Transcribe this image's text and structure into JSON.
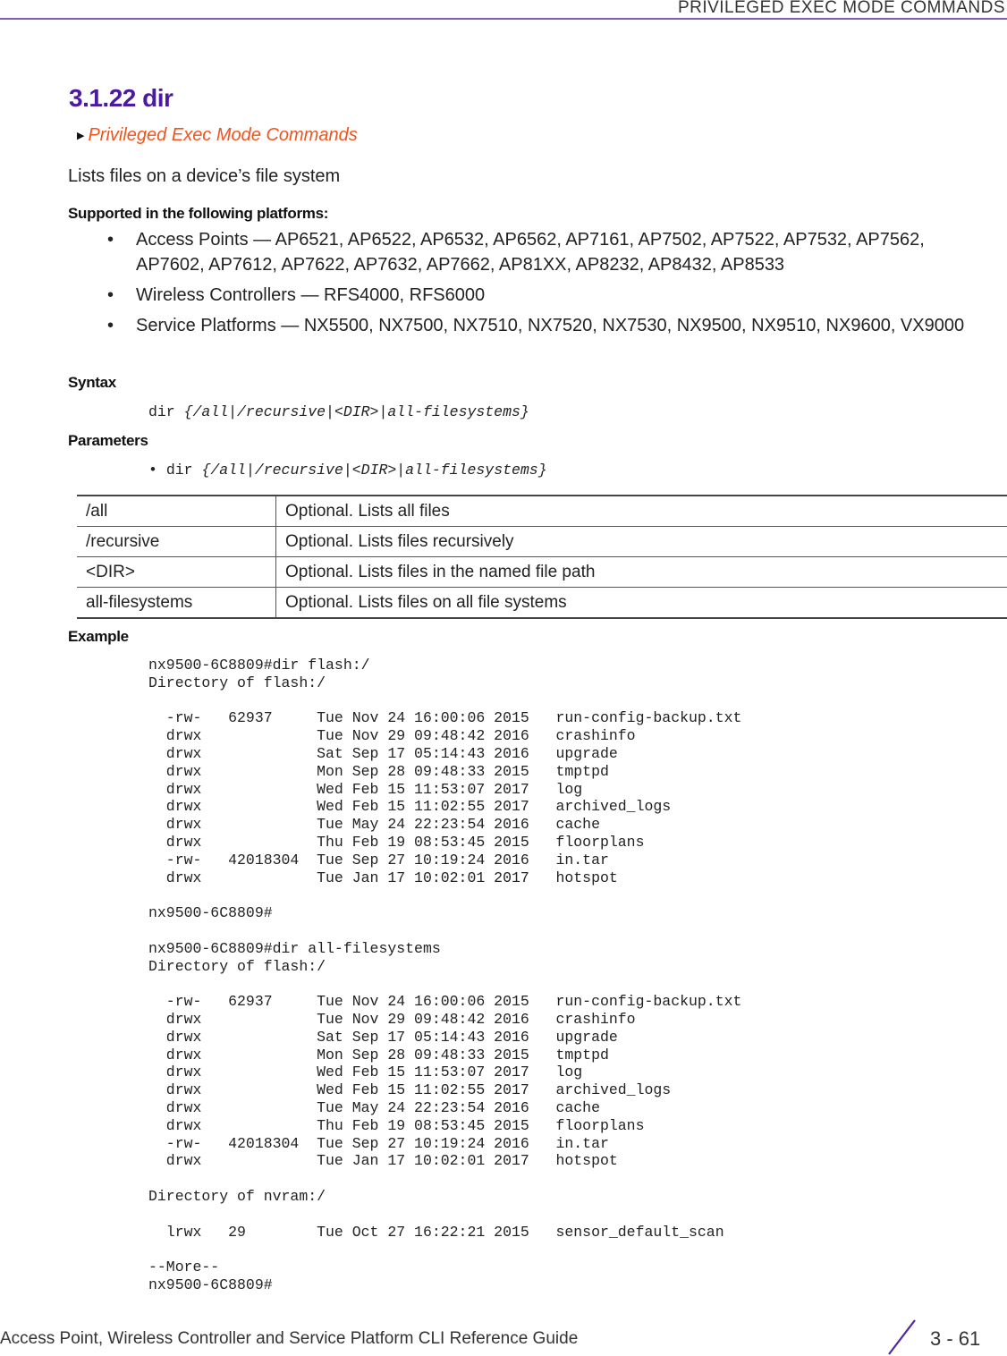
{
  "header": {
    "running_title": "PRIVILEGED EXEC MODE COMMANDS",
    "rule_color": "#7d5cc4"
  },
  "section": {
    "title": "3.1.22 dir",
    "breadcrumb_link": "Privileged Exec Mode Commands",
    "description": "Lists files on a device’s file system"
  },
  "platforms": {
    "heading": "Supported in the following platforms:",
    "bullet": "•",
    "items": [
      "Access Points — AP6521, AP6522, AP6532, AP6562, AP7161, AP7502, AP7522, AP7532, AP7562, AP7602, AP7612, AP7622, AP7632, AP7662, AP81XX, AP8232, AP8432, AP8533",
      "Wireless Controllers — RFS4000, RFS6000",
      "Service Platforms — NX5500, NX7500, NX7510, NX7520, NX7530, NX9500, NX9510, NX9600, VX9000"
    ]
  },
  "syntax": {
    "heading": "Syntax",
    "command": "dir",
    "args": "{/all|/recursive|<DIR>|all-filesystems}"
  },
  "parameters": {
    "heading": "Parameters",
    "bullet": "•",
    "command": "dir",
    "args": "{/all|/recursive|<DIR>|all-filesystems}",
    "rows": [
      {
        "param": "/all",
        "desc": "Optional. Lists all files"
      },
      {
        "param": "/recursive",
        "desc": "Optional. Lists files recursively"
      },
      {
        "param": "<DIR>",
        "desc": "Optional. Lists files in the named file path"
      },
      {
        "param": "all-filesystems",
        "desc": "Optional. Lists files on all file systems"
      }
    ]
  },
  "example": {
    "heading": "Example",
    "code": "nx9500-6C8809#dir flash:/\nDirectory of flash:/\n\n  -rw-   62937     Tue Nov 24 16:00:06 2015   run-config-backup.txt\n  drwx             Tue Nov 29 09:48:42 2016   crashinfo\n  drwx             Sat Sep 17 05:14:43 2016   upgrade\n  drwx             Mon Sep 28 09:48:33 2015   tmptpd\n  drwx             Wed Feb 15 11:53:07 2017   log\n  drwx             Wed Feb 15 11:02:55 2017   archived_logs\n  drwx             Tue May 24 22:23:54 2016   cache\n  drwx             Thu Feb 19 08:53:45 2015   floorplans\n  -rw-   42018304  Tue Sep 27 10:19:24 2016   in.tar\n  drwx             Tue Jan 17 10:02:01 2017   hotspot\n\nnx9500-6C8809#\n\nnx9500-6C8809#dir all-filesystems\nDirectory of flash:/\n\n  -rw-   62937     Tue Nov 24 16:00:06 2015   run-config-backup.txt\n  drwx             Tue Nov 29 09:48:42 2016   crashinfo\n  drwx             Sat Sep 17 05:14:43 2016   upgrade\n  drwx             Mon Sep 28 09:48:33 2015   tmptpd\n  drwx             Wed Feb 15 11:53:07 2017   log\n  drwx             Wed Feb 15 11:02:55 2017   archived_logs\n  drwx             Tue May 24 22:23:54 2016   cache\n  drwx             Thu Feb 19 08:53:45 2015   floorplans\n  -rw-   42018304  Tue Sep 27 10:19:24 2016   in.tar\n  drwx             Tue Jan 17 10:02:01 2017   hotspot\n\nDirectory of nvram:/\n\n  lrwx   29        Tue Oct 27 16:22:21 2015   sensor_default_scan\n\n--More--\nnx9500-6C8809#"
  },
  "footer": {
    "guide_title": "Access Point, Wireless Controller and Service Platform CLI Reference Guide",
    "page_number": "3 - 61",
    "accent_color": "#4b2aa0"
  }
}
